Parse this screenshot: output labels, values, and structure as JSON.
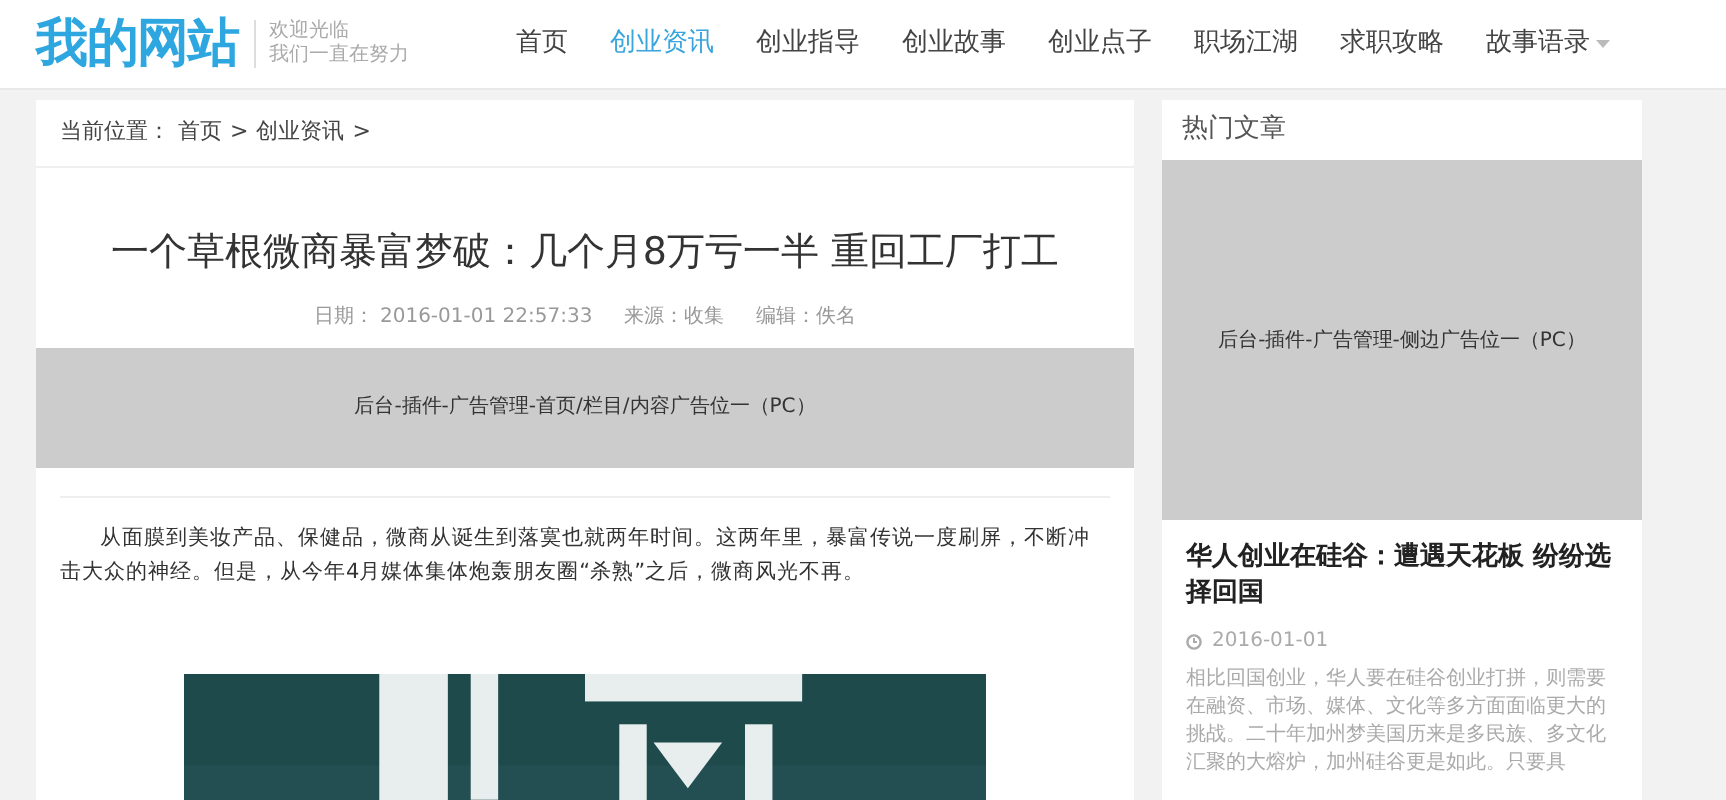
{
  "logo": {
    "title": "我的网站",
    "slogan_lines": [
      "欢迎光临",
      "我们一直在努力"
    ]
  },
  "nav": [
    {
      "label": "首页",
      "selected": false,
      "dropdown": false
    },
    {
      "label": "创业资讯",
      "selected": true,
      "dropdown": false
    },
    {
      "label": "创业指导",
      "selected": false,
      "dropdown": false
    },
    {
      "label": "创业故事",
      "selected": false,
      "dropdown": false
    },
    {
      "label": "创业点子",
      "selected": false,
      "dropdown": false
    },
    {
      "label": "职场江湖",
      "selected": false,
      "dropdown": false
    },
    {
      "label": "求职攻略",
      "selected": false,
      "dropdown": false
    },
    {
      "label": "故事语录",
      "selected": false,
      "dropdown": true
    }
  ],
  "breadcrumb": [
    "当前位置：",
    "首页",
    ">",
    "创业资讯",
    ">"
  ],
  "article": {
    "title": "一个草根微商暴富梦破：几个月8万亏一半 重回工厂打工",
    "meta": [
      "日期： 2016-01-01 22:57:33",
      "来源：收集",
      "编辑：佚名"
    ],
    "ad": "后台-插件-广告管理-首页/栏目/内容广告位一（PC）",
    "paragraph": "从面膜到美妆产品、保健品，微商从诞生到落寞也就两年时间。这两年里，暴富传说一度刷屏，不断冲击大众的神经。但是，从今年4月媒体集体炮轰朋友圈“杀熟”之后，微商风光不再。"
  },
  "sidebar": {
    "title": "热门文章",
    "ad": "后台-插件-广告管理-侧边广告位一（PC）",
    "posts": [
      {
        "title": "华人创业在硅谷：遭遇天花板 纷纷选择回国",
        "date": "2016-01-01",
        "excerpt": "相比回国创业，华人要在硅谷创业打拼，则需要在融资、市场、媒体、文化等多方面面临更大的挑战。二十年加州梦美国历来是多民族、多文化汇聚的大熔炉，加州硅谷更是如此。只要具"
      }
    ]
  }
}
